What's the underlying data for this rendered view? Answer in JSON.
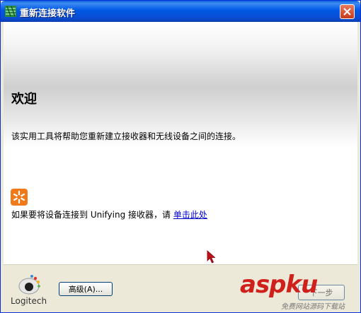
{
  "window": {
    "title": "重新连接软件"
  },
  "content": {
    "heading": "欢迎",
    "description": "该实用工具将帮助您重新建立接收器和无线设备之间的连接。",
    "unifying_text": "如果要将设备连接到 Unifying 接收器，请 ",
    "unifying_link": "单击此处"
  },
  "footer": {
    "logo_text": "Logitech",
    "advanced_button": "高级(A)...",
    "next_button": "下一步",
    "watermark": "aspku",
    "watermark_sub": "免费网站源码下载站"
  },
  "colors": {
    "title_bar": "#0058e6",
    "close_button": "#c7391c",
    "link": "#0000cc",
    "unifying_icon": "#f07a1a"
  }
}
